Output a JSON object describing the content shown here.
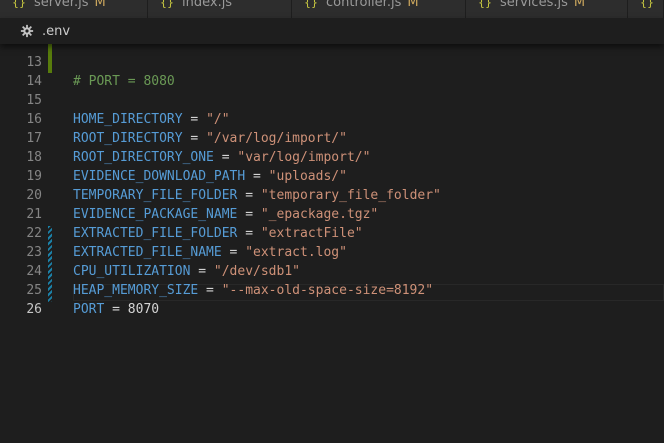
{
  "tabs": [
    {
      "label": "server.js",
      "modified": "M"
    },
    {
      "label": "index.js",
      "modified": ""
    },
    {
      "label": "controller.js",
      "modified": "M"
    },
    {
      "label": "services.js",
      "modified": "M"
    },
    {
      "label": "",
      "modified": ""
    }
  ],
  "breadcrumb": {
    "file": ".env"
  },
  "editor": {
    "lines": [
      {
        "num": "13",
        "key": "",
        "op": "",
        "val": "",
        "comment": "# PORT = 8080"
      },
      {
        "num": "14",
        "key": "",
        "op": "",
        "val": "",
        "comment": ""
      },
      {
        "num": "15",
        "key": "HOME_DIRECTORY",
        "op": " = ",
        "val": "\"/\"",
        "comment": ""
      },
      {
        "num": "16",
        "key": "ROOT_DIRECTORY",
        "op": " = ",
        "val": "\"/var/log/import/\"",
        "comment": ""
      },
      {
        "num": "17",
        "key": "ROOT_DIRECTORY_ONE",
        "op": " = ",
        "val": "\"var/log/import/\"",
        "comment": ""
      },
      {
        "num": "18",
        "key": "EVIDENCE_DOWNLOAD_PATH",
        "op": " = ",
        "val": "\"uploads/\"",
        "comment": ""
      },
      {
        "num": "19",
        "key": "TEMPORARY_FILE_FOLDER",
        "op": " = ",
        "val": "\"temporary_file_folder\"",
        "comment": ""
      },
      {
        "num": "20",
        "key": "EVIDENCE_PACKAGE_NAME",
        "op": " = ",
        "val": "\"_epackage.tgz\"",
        "comment": ""
      },
      {
        "num": "21",
        "key": "EXTRACTED_FILE_FOLDER",
        "op": " = ",
        "val": "\"extractFile\"",
        "comment": ""
      },
      {
        "num": "22",
        "key": "EXTRACTED_FILE_NAME",
        "op": " = ",
        "val": "\"extract.log\"",
        "comment": ""
      },
      {
        "num": "23",
        "key": "CPU_UTILIZATION",
        "op": " = ",
        "val": "\"/dev/sdb1\"",
        "comment": ""
      },
      {
        "num": "24",
        "key": "HEAP_MEMORY_SIZE",
        "op": " = ",
        "val": "\"--max-old-space-size=8192\"",
        "comment": ""
      },
      {
        "num": "25",
        "key": "PORT",
        "op": " = ",
        "val": "8070",
        "comment": ""
      },
      {
        "num": "26",
        "key": "",
        "op": "",
        "val": "",
        "comment": ""
      }
    ]
  },
  "colors": {
    "background": "#1e1e1e",
    "keyword": "#569cd6",
    "string": "#ce9178",
    "number": "#d4d4d4",
    "line_number": "#858585",
    "gutter_added": "#587c0c",
    "gutter_modified": "#1b81a8"
  },
  "icons": {
    "breadcrumb": "gear-icon",
    "tab": "js-file-icon"
  }
}
